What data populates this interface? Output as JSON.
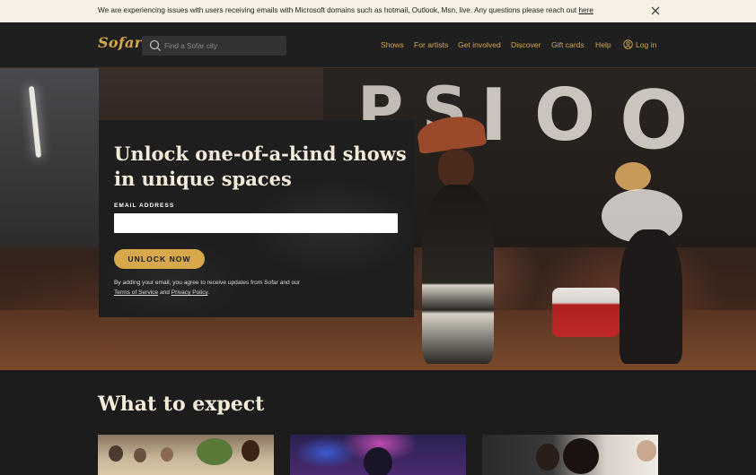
{
  "announcement": {
    "text": "We are experiencing issues with users receiving emails with Microsoft domains such as hotmail, Outlook, Msn, live. Any questions please reach out ",
    "link_label": "here",
    "close_icon": "close-icon"
  },
  "header": {
    "logo": "Sofar",
    "search": {
      "placeholder": "Find a Sofar city",
      "value": "",
      "icon": "search-icon"
    },
    "nav": [
      {
        "label": "Shows"
      },
      {
        "label": "For artists"
      },
      {
        "label": "Get involved"
      },
      {
        "label": "Discover"
      },
      {
        "label": "Gift cards"
      },
      {
        "label": "Help"
      },
      {
        "label": "Log in",
        "icon": "user-icon"
      }
    ],
    "accent_color": "#d4a64a"
  },
  "hero": {
    "title": "Unlock one-of-a-kind shows in unique spaces",
    "email_label": "EMAIL ADDRESS",
    "email_value": "",
    "button_label": "UNLOCK NOW",
    "consent_prefix": "By adding your email, you agree to receive updates from Sofar and our ",
    "terms_label": "Terms of Service",
    "consent_and": " and ",
    "privacy_label": "Privacy Policy",
    "consent_suffix": ".",
    "background_letters": [
      "P",
      "S",
      "I",
      "O",
      "O"
    ],
    "button_color": "#d8a84c"
  },
  "expect": {
    "title": "What to expect"
  }
}
